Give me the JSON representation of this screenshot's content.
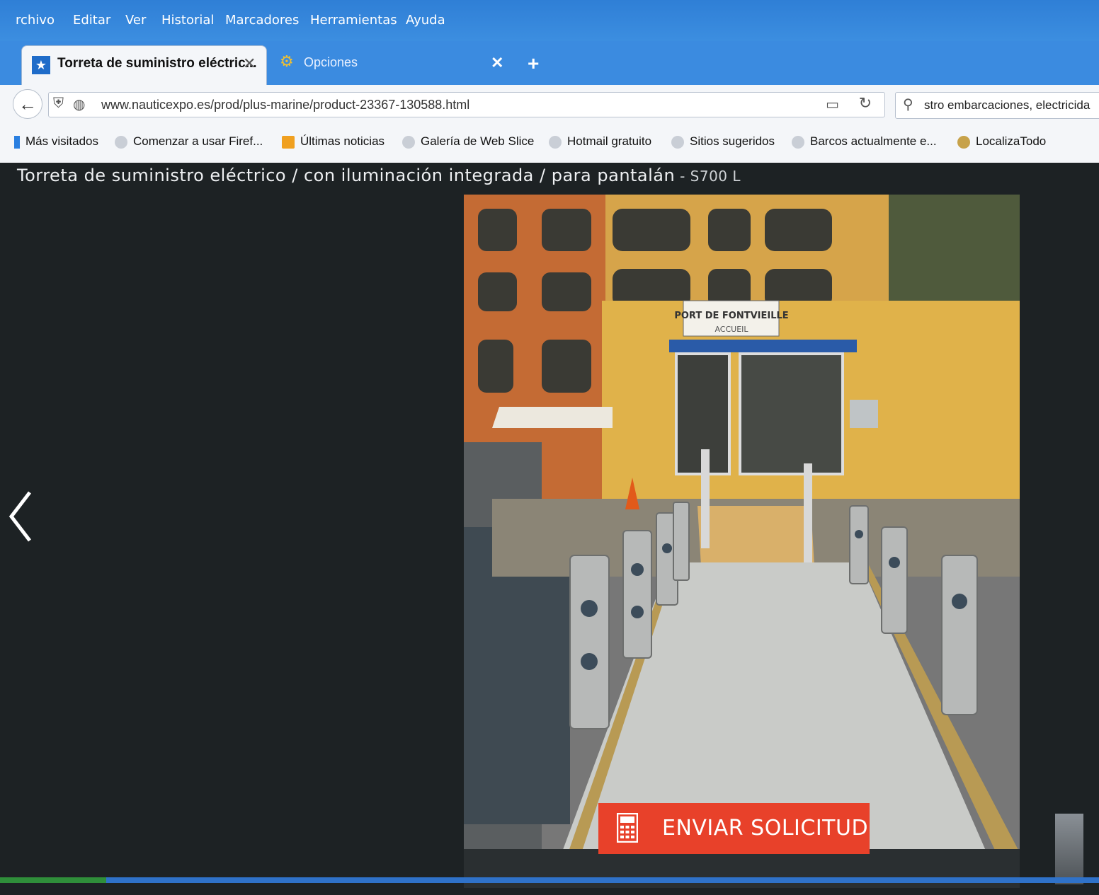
{
  "menu": [
    "rchivo",
    "Editar",
    "Ver",
    "Historial",
    "Marcadores",
    "Herramientas",
    "Ayuda"
  ],
  "tabs": {
    "active_title": "Torreta de suministro eléctric...",
    "second_title": "Opciones",
    "close_symbol": "✕",
    "new_tab_symbol": "+"
  },
  "nav": {
    "url": "www.nauticexpo.es/prod/plus-marine/product-23367-130588.html",
    "search_text": "stro embarcaciones, electricida"
  },
  "bookmarks": [
    "Más visitados",
    "Comenzar a usar Firef...",
    "Últimas noticias",
    "Galería de Web Slice",
    "Hotmail gratuito",
    "Sitios sugeridos",
    "Barcos actualmente e...",
    "LocalizaTodo"
  ],
  "product": {
    "title": "Torreta de suministro eléctrico / con iluminación integrada / para pantalán",
    "code": " - S700 L",
    "cta_label": "ENVIAR SOLICITUD",
    "photo_sign_line1": "PORT DE FONTVIEILLE",
    "photo_sign_line2": "ACCUEIL"
  },
  "colors": {
    "browser_blue": "#3b8be0",
    "cta_red": "#e8412a",
    "viewer_bg": "#1d2224"
  }
}
